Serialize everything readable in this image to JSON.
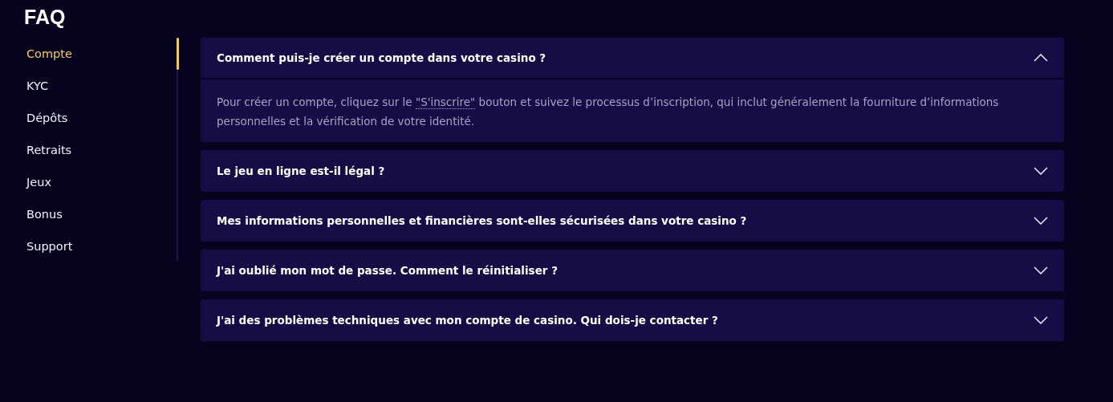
{
  "title": "FAQ",
  "sidebar": {
    "items": [
      {
        "label": "Compte",
        "selected": true
      },
      {
        "label": "KYC",
        "selected": false
      },
      {
        "label": "Dépôts",
        "selected": false
      },
      {
        "label": "Retraits",
        "selected": false
      },
      {
        "label": "Jeux",
        "selected": false
      },
      {
        "label": "Bonus",
        "selected": false
      },
      {
        "label": "Support",
        "selected": false
      }
    ]
  },
  "faq": [
    {
      "question": "Comment puis-je créer un compte dans votre casino ?",
      "expanded": true,
      "answer": {
        "before": "Pour créer un compte, cliquez sur le ",
        "link": "\"S'inscrire\"",
        "after": " bouton et suivez le processus d’inscription, qui inclut généralement la fourniture d’informations personnelles et la vérification de votre identité."
      }
    },
    {
      "question": "Le jeu en ligne est-il légal ?",
      "expanded": false
    },
    {
      "question": "Mes informations personnelles et financières sont-elles sécurisées dans votre casino ?",
      "expanded": false
    },
    {
      "question": "J'ai oublié mon mot de passe. Comment le réinitialiser ?",
      "expanded": false
    },
    {
      "question": "J'ai des problèmes techniques avec mon compte de casino. Qui dois-je contacter ?",
      "expanded": false
    }
  ]
}
